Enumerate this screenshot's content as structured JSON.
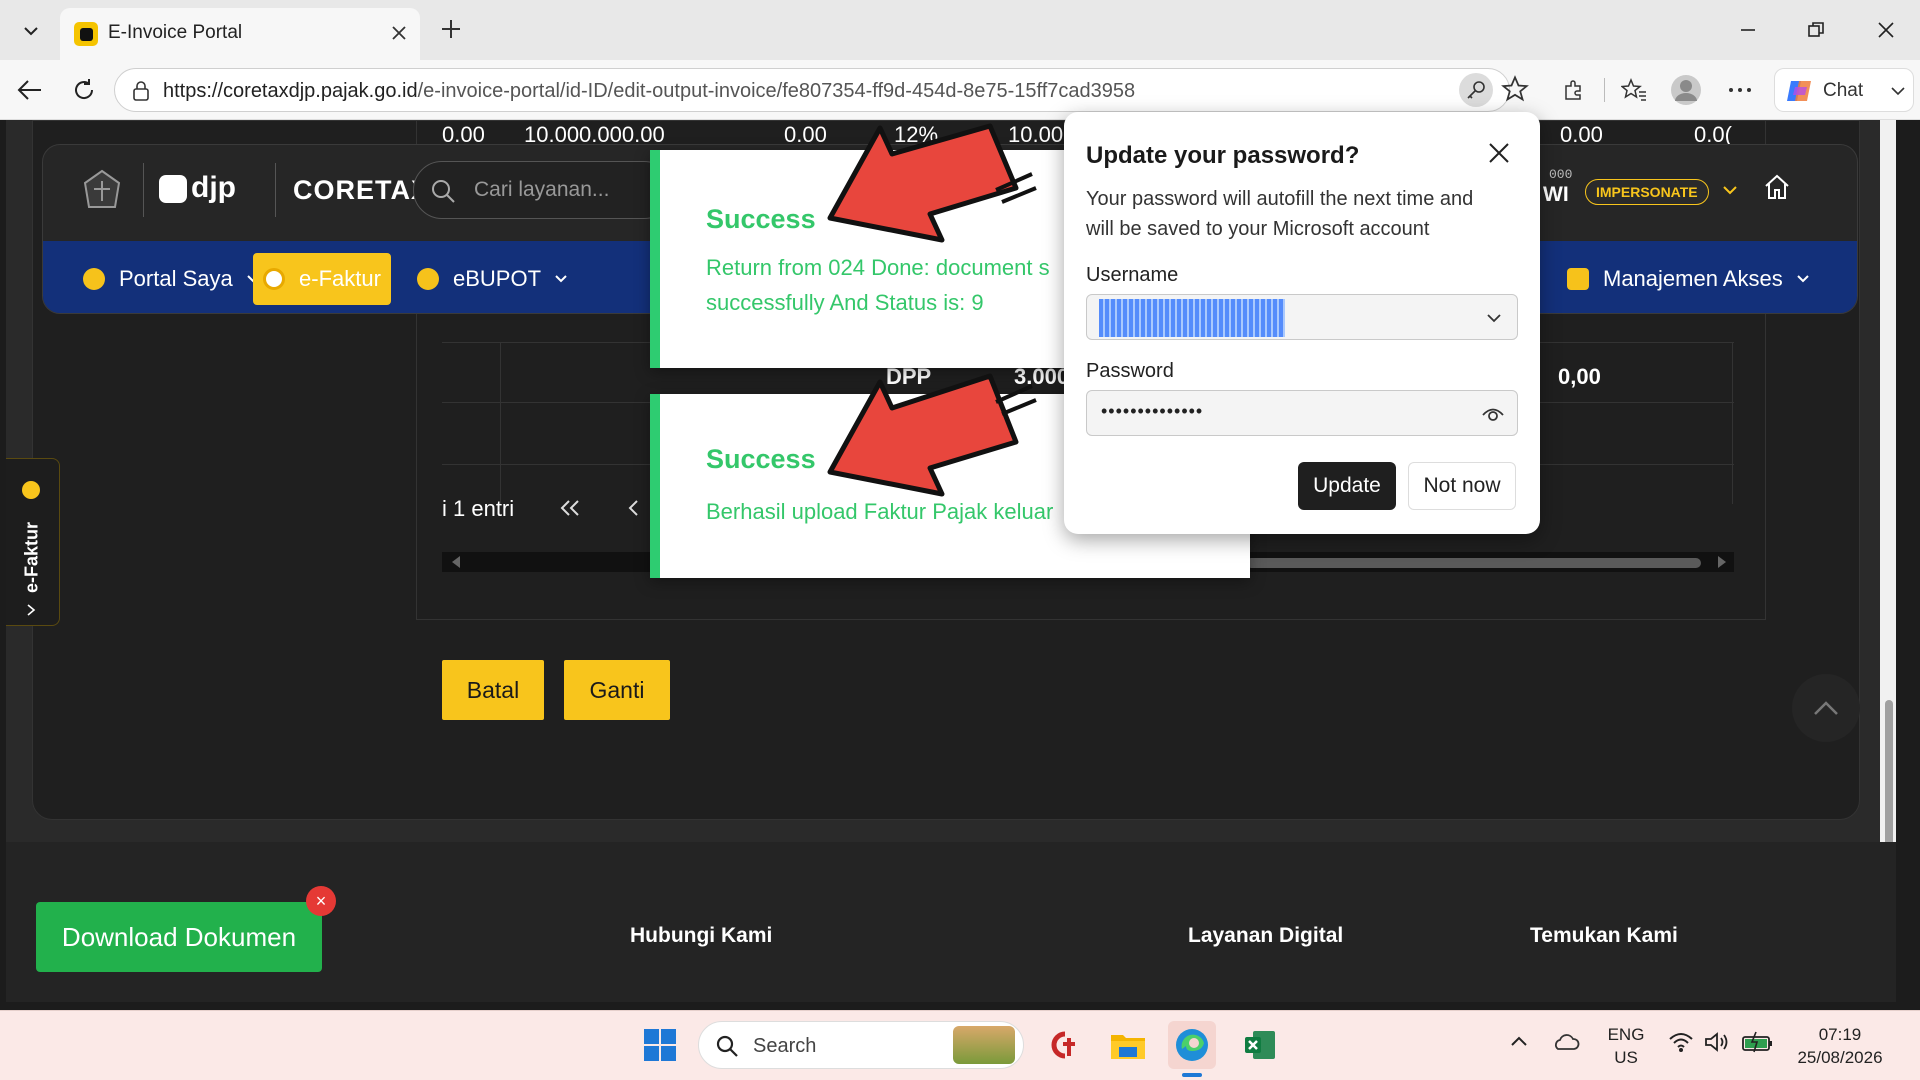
{
  "browser": {
    "tab_title": "E-Invoice Portal",
    "url_host": "https://coretaxdjp.pajak.go.id",
    "url_path": "/e-invoice-portal/id-ID/edit-output-invoice/fe807354-ff9d-454d-8e75-15ff7cad3958",
    "chat_label": "Chat"
  },
  "header": {
    "logo_djp": "djp",
    "logo_coretax": "CORETAX",
    "search_placeholder": "Cari layanan...",
    "user_initials": "WI",
    "user_code": "000",
    "impersonate_badge": "IMPERSONATE"
  },
  "nav": {
    "items": [
      {
        "label": "Portal Saya"
      },
      {
        "label": "e-Faktur"
      },
      {
        "label": "eBUPOT"
      },
      {
        "label": "Manajemen Akses"
      }
    ]
  },
  "table": {
    "top_row": [
      "0.00",
      "10.000.000.00",
      "0.00",
      "12%",
      "10.00",
      "0.00",
      "0.0("
    ],
    "dpp_label": "DPP",
    "dpp_value": "3.000",
    "right_value": "0,00",
    "pagination_text": "i 1 entri"
  },
  "actions": {
    "cancel_label": "Batal",
    "replace_label": "Ganti"
  },
  "side_tab": {
    "label": "e-Faktur"
  },
  "toasts": [
    {
      "title": "Success",
      "message_line1": "Return from 024 Done: document s",
      "message_line2": "successfully And Status is: 9"
    },
    {
      "title": "Success",
      "message_line1": "Berhasil upload Faktur Pajak keluar"
    }
  ],
  "password_popup": {
    "title": "Update your password?",
    "description_line1": "Your password will autofill the next time and",
    "description_line2": "will be saved to your Microsoft account",
    "username_label": "Username",
    "password_label": "Password",
    "password_mask": "••••••••••••••",
    "update_label": "Update",
    "not_now_label": "Not now"
  },
  "download": {
    "label": "Download Dokumen",
    "close_glyph": "×"
  },
  "footer": {
    "links": [
      "Hubungi Kami",
      "Layanan Digital",
      "Temukan Kami"
    ]
  },
  "taskbar": {
    "search_label": "Search",
    "lang_line1": "ENG",
    "lang_line2": "US",
    "time": "07:19",
    "date": "25/08/2026"
  },
  "colors": {
    "accent_yellow": "#f8c51c",
    "nav_blue": "#13307a",
    "success_green": "#34c76a",
    "download_green": "#22b14c",
    "close_red": "#e53935"
  }
}
